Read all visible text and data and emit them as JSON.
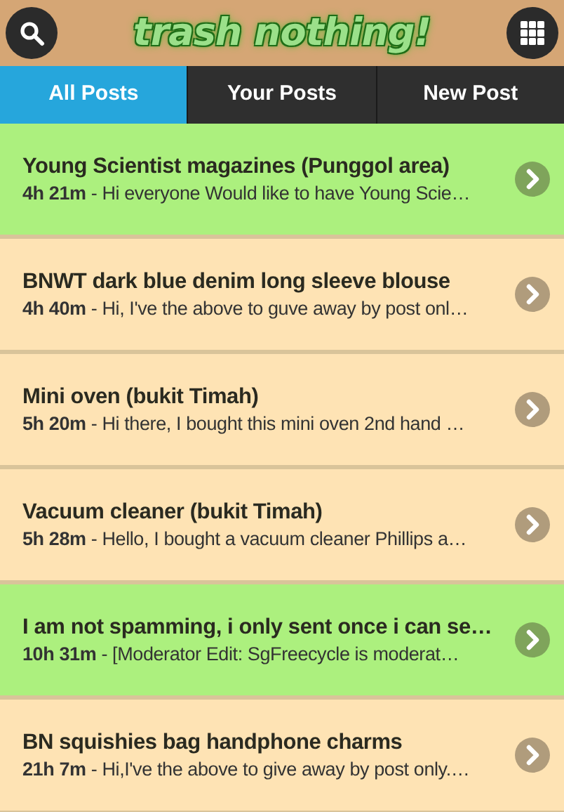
{
  "header": {
    "logo": "trash nothing!"
  },
  "tabs": [
    {
      "label": "All Posts",
      "selected": true
    },
    {
      "label": "Your Posts",
      "selected": false
    },
    {
      "label": "New Post",
      "selected": false
    }
  ],
  "posts": [
    {
      "title": "Young Scientist magazines (Punggol area)",
      "age": "4h 21m",
      "preview": " - Hi everyone Would like to have Young Scie…",
      "color": "#acf07e"
    },
    {
      "title": "BNWT dark blue denim long sleeve blouse",
      "age": "4h 40m",
      "preview": " - Hi, I've the above to guve away by post onl…",
      "color": "#fee3b4"
    },
    {
      "title": "Mini oven (bukit Timah)",
      "age": "5h 20m",
      "preview": " - Hi there, I bought this mini oven 2nd hand …",
      "color": "#fee3b4"
    },
    {
      "title": "Vacuum cleaner (bukit Timah)",
      "age": "5h 28m",
      "preview": " - Hello, I bought a vacuum cleaner Phillips a…",
      "color": "#fee3b4"
    },
    {
      "title": "I am not spamming, i only sent once i can se…",
      "age": "10h 31m",
      "preview": " - [Moderator Edit: SgFreecycle is moderat…",
      "color": "#acf07e"
    },
    {
      "title": "BN squishies bag handphone charms",
      "age": "21h 7m",
      "preview": " - Hi,I've the above to give away by post only.…",
      "color": "#fee3b4"
    }
  ]
}
